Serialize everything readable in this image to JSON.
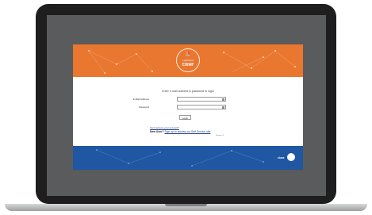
{
  "logo": {
    "mark": "⛵",
    "org_line": "Leuphana Universität",
    "name": "Lüner"
  },
  "login": {
    "prompt": "Enter e-mail address & password to login",
    "email_label": "E-Mail Address",
    "password_label": "Password",
    "login_button": "Login",
    "forgot_link": "Can't access your account?",
    "new_user_lead": "New User?",
    "new_user_link": "Sign up to access our Self Service site",
    "small_note": "Version 1.0"
  },
  "footer_brand": {
    "text": "sluse"
  },
  "colors": {
    "orange": "#e9772f",
    "blue": "#1f57a3",
    "laptop_body": "#1e1e1f",
    "bezel": "#5a5b5c"
  }
}
